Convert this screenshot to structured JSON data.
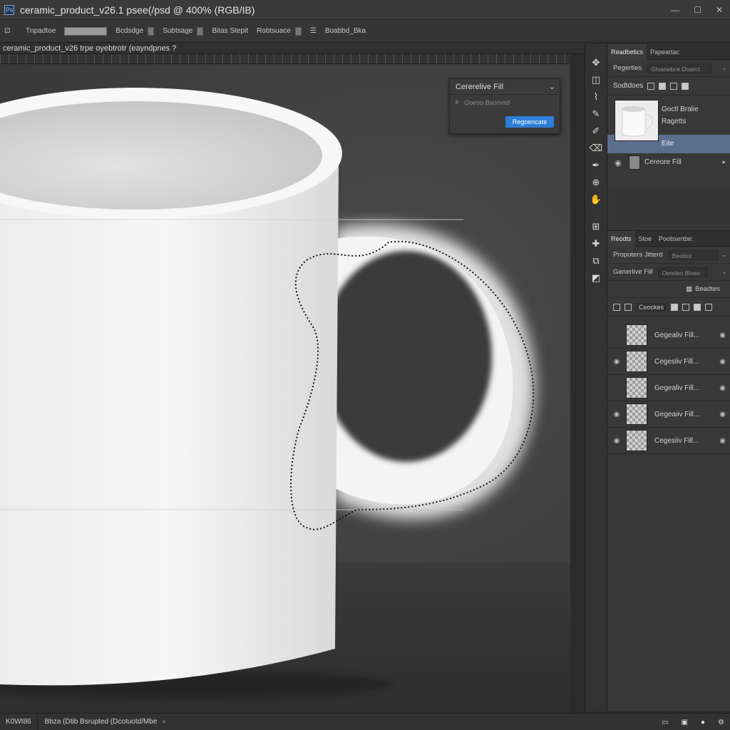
{
  "window": {
    "title": "ceramic_product_v26.1 psee(/psd @ 400% (RGB/IB)",
    "doc_tab": "ceramic_product_v26 trpe oyebtrotr (eayndpnes ?"
  },
  "options_bar": {
    "items": [
      "Tnpadtoe",
      "Bcdsdge",
      "Subtsage",
      "Bitas Stepit",
      "Robtsuace",
      "Boabbd_Bka"
    ]
  },
  "generative_fill_panel": {
    "title": "Cererelive Fill",
    "prompt_placeholder": "Ooeoo Bsonvsd",
    "button_label": "Regnencate"
  },
  "status_bar": {
    "zoom": "K0WI86",
    "info": "Bbza (Dtib Bsrupted (Dcotuotd/Mbe"
  },
  "properties_panel": {
    "tabs": [
      "Readbetics",
      "Papeartac"
    ],
    "row1_label": "Pegerties",
    "row1_value": "Gloanebce Doarct",
    "icons_row_label": "Sodtdoes",
    "item_label_1": "Goctl Bralie",
    "item_label_2": "Ragetts",
    "selected_label": "Eite",
    "item_label_3": "Cereore Fill"
  },
  "layers_panel": {
    "tabs": [
      "Reodts",
      "Stoe",
      "Poobsertbe:"
    ],
    "row1_label": "Propoters Jitterd",
    "row1_value": "Beotrot",
    "row2_label": "Generlive Fill",
    "row2_value": "Oeodes Bloes",
    "row3_value": "Beadtes",
    "toolbar_label": "Ceockes",
    "layers": [
      {
        "name": "Gegealiv Fill...",
        "visible": false
      },
      {
        "name": "Cegesliv Fill...",
        "visible": true
      },
      {
        "name": "Gegealiv Fill...",
        "visible": false
      },
      {
        "name": "Gegeaiiv Fill...",
        "visible": true
      },
      {
        "name": "Cegesiiv Fill...",
        "visible": true
      }
    ]
  },
  "tools": [
    "move-icon",
    "marquee-icon",
    "lasso-icon",
    "brush-icon",
    "eyedropper-icon",
    "eraser-icon",
    "pen-icon",
    "stamp-icon",
    "hand-icon",
    "crop-icon",
    "arrange-icon",
    "zoom-icon",
    "swap-icon",
    "color-swatch-icon"
  ],
  "colors": {
    "accent": "#2d7fd8",
    "selection": "#5c6e8e",
    "background": "#2b2b2b"
  }
}
